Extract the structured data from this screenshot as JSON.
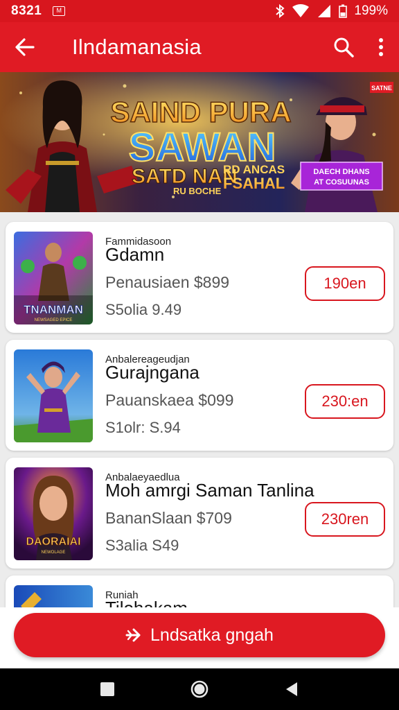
{
  "status_bar": {
    "time": "8321",
    "mini_badge": "M",
    "battery": "199%"
  },
  "app_bar": {
    "title": "Ilndamanasia",
    "back_icon": "arrow-back-icon",
    "search_icon": "search-icon",
    "more_icon": "more-vert-icon"
  },
  "banner": {
    "title_line1": "SAIND PURA",
    "title_line2": "SAWAN",
    "line3": "SATD NAN",
    "line3_small": "RD ANCAS",
    "line4_left": "RU BOCHE",
    "line4_right": "FSAHAL",
    "corner_badge": "SATNE",
    "promo_box_line1": "DAECH DHANS",
    "promo_box_line2": "AT COSUUNAS"
  },
  "items": [
    {
      "kicker": "Fammidasoon",
      "name": "Gdamn",
      "price": "Penausiaen $899",
      "sale": "S5olia 9.49",
      "button": "190en",
      "thumb_text": "TNANMAN",
      "thumb_sub": "NEWSAGED EPICE"
    },
    {
      "kicker": "Anbalereageudjan",
      "name": "Gurajngana",
      "price": "Pauanskaea $099",
      "sale": "S1olr: S.94",
      "button": "230:en",
      "thumb_text": "",
      "thumb_sub": ""
    },
    {
      "kicker": "Anbalaeyaedlua",
      "name": "Moh amrgi Saman Tanlina",
      "price": "BananSlaan $709",
      "sale": "S3alia S49",
      "button": "230ren",
      "thumb_text": "DAORAIAI",
      "thumb_sub": "NEWOLAGE"
    },
    {
      "kicker": "Runiah",
      "name": "Tilohakam",
      "price": "",
      "sale": "",
      "button": "",
      "thumb_text": "",
      "thumb_sub": ""
    }
  ],
  "cta": {
    "label": "Lndsatka gngah",
    "icon": "plane-icon"
  },
  "colors": {
    "primary": "#e01b24",
    "status": "#d8161e",
    "background": "#ececec"
  }
}
